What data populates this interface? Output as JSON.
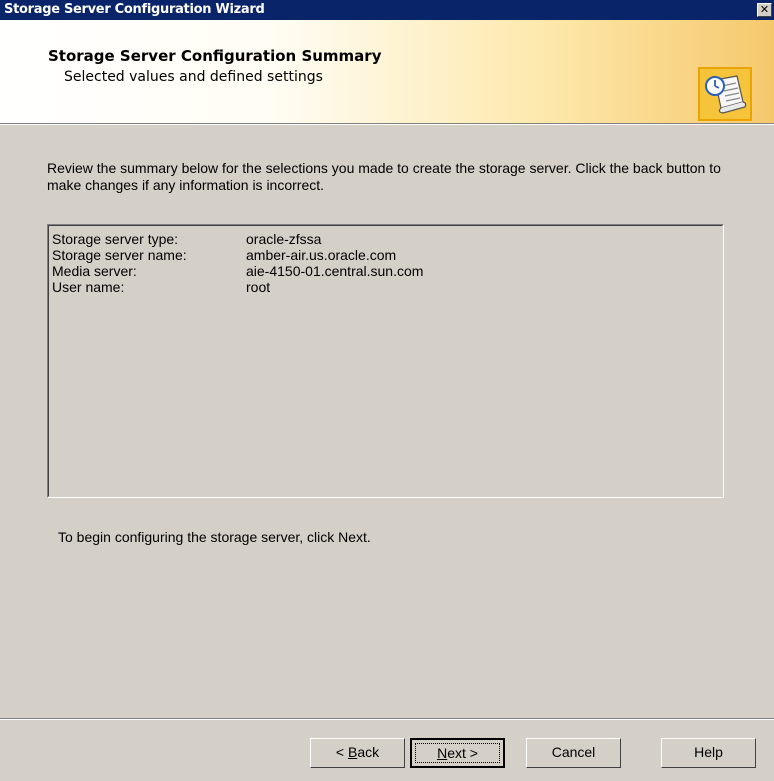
{
  "window": {
    "title": "Storage Server Configuration Wizard",
    "close_glyph": "✕"
  },
  "header": {
    "title": "Storage Server Configuration Summary",
    "subtitle": "Selected values and defined settings",
    "icon": "wizard-scroll-icon"
  },
  "intro": "Review the summary below for the selections you made to create the storage server. Click the back button to make changes if any information is incorrect.",
  "summary": [
    {
      "label": "Storage server type:",
      "value": "oracle-zfssa"
    },
    {
      "label": "Storage server name:",
      "value": "amber-air.us.oracle.com"
    },
    {
      "label": "Media server:",
      "value": "aie-4150-01.central.sun.com"
    },
    {
      "label": "User name:",
      "value": "root"
    }
  ],
  "hint": "To begin configuring the storage server, click Next.",
  "buttons": {
    "back": {
      "prefix": "< ",
      "mnemonic": "B",
      "rest": "ack"
    },
    "next": {
      "mnemonic": "N",
      "rest": "ext >"
    },
    "cancel": "Cancel",
    "help": "Help"
  }
}
